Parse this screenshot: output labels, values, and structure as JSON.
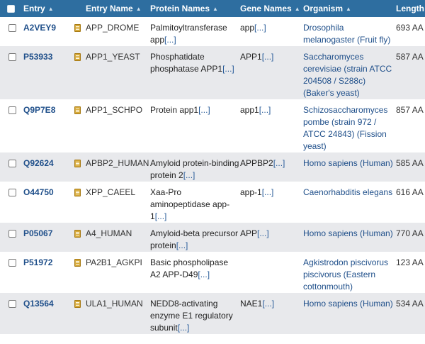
{
  "columns": {
    "entry": "Entry",
    "entry_name": "Entry Name",
    "protein_names": "Protein Names",
    "gene_names": "Gene Names",
    "organism": "Organism",
    "length": "Length",
    "sort_glyph": "▲"
  },
  "more_marker": "[...]",
  "rows": [
    {
      "entry": "A2VEY9",
      "entry_name": "APP_DROME",
      "protein": "Palmitoyltransferase app",
      "gene": "app",
      "organism": "Drosophila melanogaster (Fruit fly)",
      "length": "693 AA"
    },
    {
      "entry": "P53933",
      "entry_name": "APP1_YEAST",
      "protein": "Phosphatidate phosphatase APP1",
      "gene": "APP1",
      "organism": "Saccharomyces cerevisiae (strain ATCC 204508 / S288c) (Baker's yeast)",
      "length": "587 AA"
    },
    {
      "entry": "Q9P7E8",
      "entry_name": "APP1_SCHPO",
      "protein": "Protein app1",
      "gene": "app1",
      "organism": "Schizosaccharomyces pombe (strain 972 / ATCC 24843) (Fission yeast)",
      "length": "857 AA"
    },
    {
      "entry": "Q92624",
      "entry_name": "APBP2_HUMAN",
      "protein": "Amyloid protein-binding protein 2",
      "gene": "APPBP2",
      "organism": "Homo sapiens (Human)",
      "length": "585 AA"
    },
    {
      "entry": "O44750",
      "entry_name": "XPP_CAEEL",
      "protein": "Xaa-Pro aminopeptidase app-1",
      "gene": "app-1",
      "organism": "Caenorhabditis elegans",
      "length": "616 AA"
    },
    {
      "entry": "P05067",
      "entry_name": "A4_HUMAN",
      "protein": "Amyloid-beta precursor protein",
      "gene": "APP",
      "organism": "Homo sapiens (Human)",
      "length": "770 AA"
    },
    {
      "entry": "P51972",
      "entry_name": "PA2B1_AGKPI",
      "protein": "Basic phospholipase A2 APP-D49",
      "gene": "",
      "organism": "Agkistrodon piscivorus piscivorus (Eastern cottonmouth)",
      "length": "123 AA"
    },
    {
      "entry": "Q13564",
      "entry_name": "ULA1_HUMAN",
      "protein": "NEDD8-activating enzyme E1 regulatory subunit",
      "gene": "NAE1",
      "organism": "Homo sapiens (Human)",
      "length": "534 AA"
    }
  ]
}
